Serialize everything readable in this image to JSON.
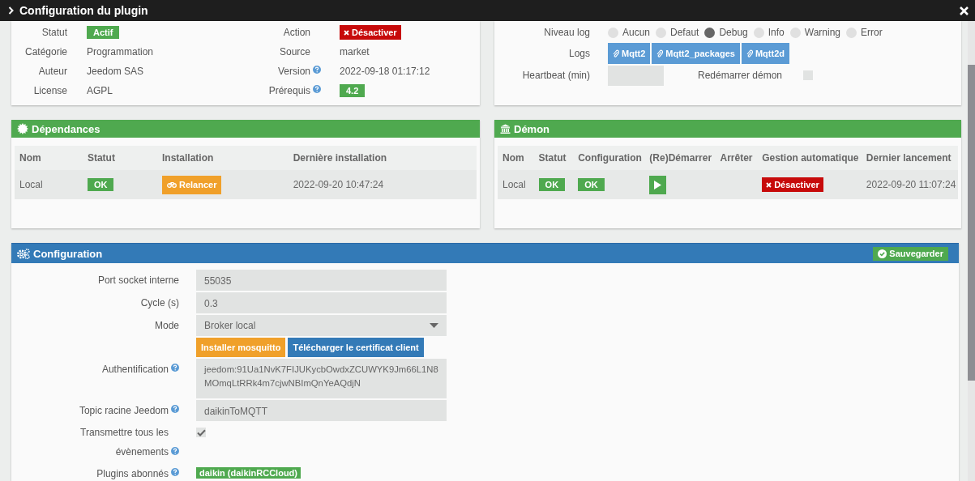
{
  "window": {
    "title": "Configuration du plugin"
  },
  "info": {
    "left": [
      {
        "label": "Statut",
        "value": "Actif",
        "kind": "badge",
        "help": false
      },
      {
        "label": "Catégorie",
        "value": "Programmation",
        "kind": "text",
        "help": false
      },
      {
        "label": "Auteur",
        "value": "Jeedom SAS",
        "kind": "text",
        "help": false
      },
      {
        "label": "License",
        "value": "AGPL",
        "kind": "text",
        "help": false
      }
    ],
    "right": [
      {
        "label": "Action",
        "value": "Désactiver",
        "kind": "danger-button",
        "help": false
      },
      {
        "label": "Source",
        "value": "market",
        "kind": "text",
        "help": false
      },
      {
        "label": "Version",
        "value": "2022-09-18 01:17:12",
        "kind": "text",
        "help": true
      },
      {
        "label": "Prérequis",
        "value": "4.2",
        "kind": "badge",
        "help": true
      }
    ]
  },
  "logging": {
    "level_label": "Niveau log",
    "levels": [
      {
        "label": "Aucun",
        "selected": false
      },
      {
        "label": "Defaut",
        "selected": false
      },
      {
        "label": "Debug",
        "selected": true
      },
      {
        "label": "Info",
        "selected": false
      },
      {
        "label": "Warning",
        "selected": false
      },
      {
        "label": "Error",
        "selected": false
      }
    ],
    "logs_label": "Logs",
    "logs": [
      "Mqtt2",
      "Mqtt2_packages",
      "Mqtt2d"
    ],
    "heartbeat_label": "Heartbeat (min)",
    "restart_label": "Redémarrer démon",
    "restart_checked": false
  },
  "dependencies": {
    "title": "Dépendances",
    "columns": [
      "Nom",
      "Statut",
      "Installation",
      "Dernière installation"
    ],
    "row": {
      "name": "Local",
      "status": "OK",
      "action": "Relancer",
      "last": "2022-09-20 10:47:24"
    }
  },
  "daemon": {
    "title": "Démon",
    "columns": [
      "Nom",
      "Statut",
      "Configuration",
      "(Re)Démarrer",
      "Arrêter",
      "Gestion automatique",
      "Dernier lancement"
    ],
    "row": {
      "name": "Local",
      "status": "OK",
      "config": "OK",
      "auto": "Désactiver",
      "last": "2022-09-20 11:07:24"
    }
  },
  "configuration": {
    "title": "Configuration",
    "save": "Sauvegarder",
    "fields": [
      {
        "kind": "input",
        "label": "Port socket interne",
        "value": "55035",
        "help": false
      },
      {
        "kind": "input",
        "label": "Cycle (s)",
        "value": "0.3",
        "help": false
      },
      {
        "kind": "select",
        "label": "Mode",
        "value": "Broker local",
        "help": false
      },
      {
        "kind": "buttons",
        "buttons": [
          {
            "label": "Installer mosquitto",
            "color": "#f0a02a"
          },
          {
            "label": "Télécharger le certificat client",
            "color": "#337ab7"
          }
        ]
      },
      {
        "kind": "textarea",
        "label": "Authentification",
        "value": "jeedom:91Ua1NvK7FIJUKycbOwdxZCUWYK9Jm66L1N8MOmqLtRRk4m7cjwNBImQnYeAQdjN",
        "help": true
      },
      {
        "kind": "input",
        "label": "Topic racine Jeedom",
        "value": "daikinToMQTT",
        "help": true
      },
      {
        "kind": "checkbox",
        "label": "Transmettre tous les évènements",
        "checked": true,
        "help": true
      },
      {
        "kind": "tags",
        "label": "Plugins abonnés",
        "tags": [
          "daikin (daikinRCCloud)"
        ],
        "help": true
      }
    ]
  }
}
